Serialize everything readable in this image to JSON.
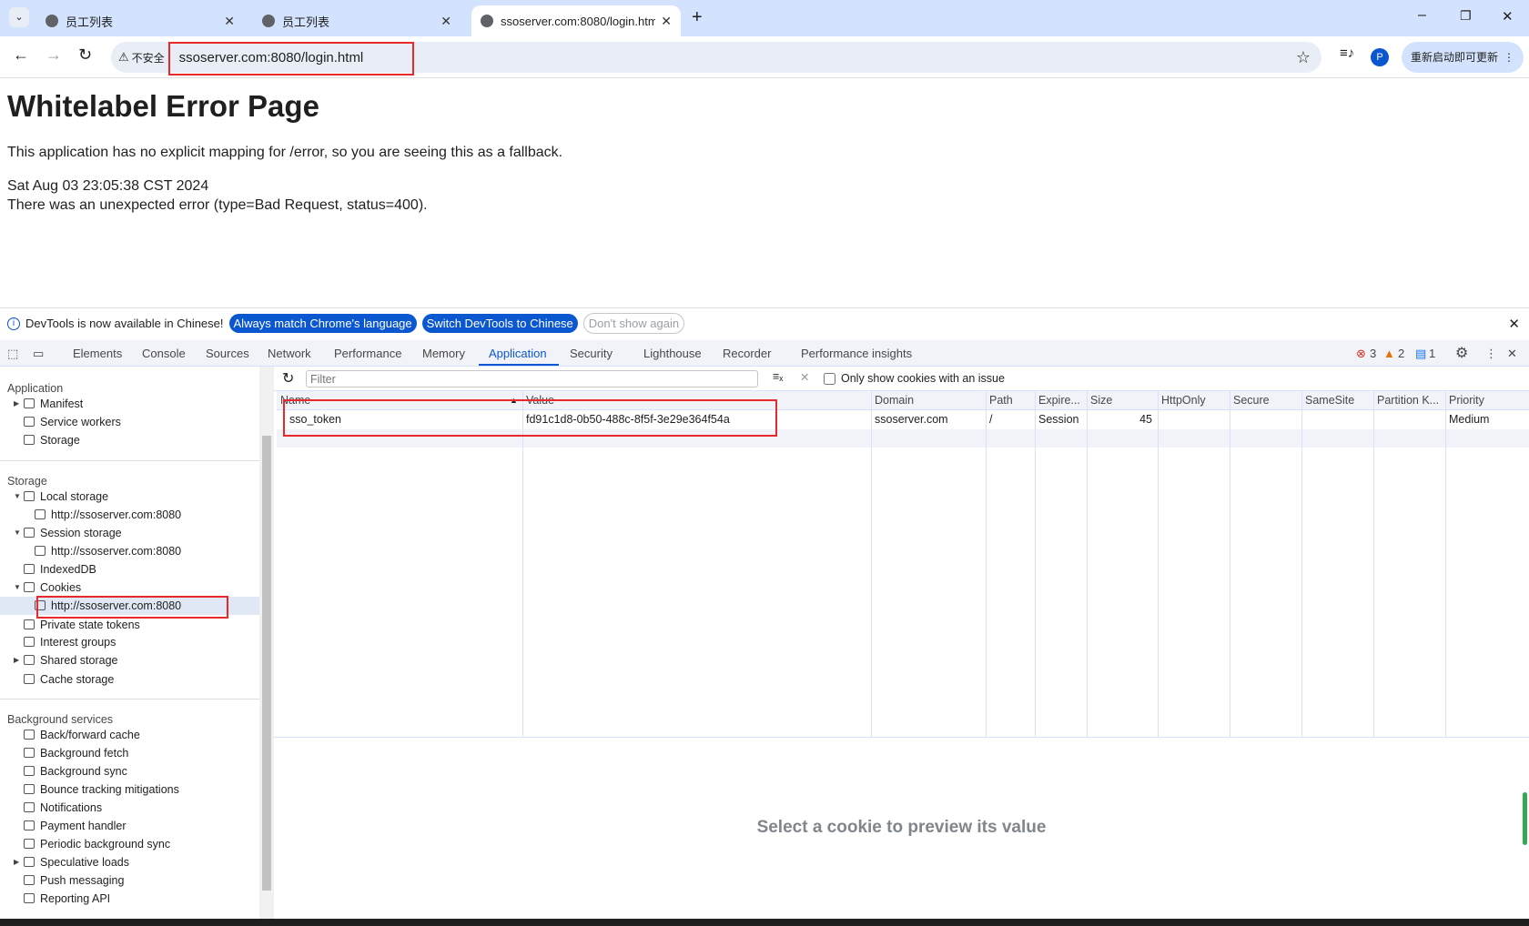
{
  "browser": {
    "tabs": [
      {
        "title": "员工列表"
      },
      {
        "title": "员工列表"
      },
      {
        "title": "ssoserver.com:8080/login.htm"
      }
    ],
    "security_label": "不安全",
    "url": "ssoserver.com:8080/login.html",
    "profile_initial": "P",
    "update_button": "重新启动即可更新"
  },
  "page": {
    "title": "Whitelabel Error Page",
    "message": "This application has no explicit mapping for /error, so you are seeing this as a fallback.",
    "timestamp": "Sat Aug 03 23:05:38 CST 2024",
    "error": "There was an unexpected error (type=Bad Request, status=400)."
  },
  "infobar": {
    "text": "DevTools is now available in Chinese!",
    "btn1": "Always match Chrome's language",
    "btn2": "Switch DevTools to Chinese",
    "btn3": "Don't show again"
  },
  "devtools": {
    "tabs": [
      "Elements",
      "Console",
      "Sources",
      "Network",
      "Performance",
      "Memory",
      "Application",
      "Security",
      "Lighthouse",
      "Recorder",
      "Performance insights"
    ],
    "active_tab": "Application",
    "errors": "3",
    "warnings": "2",
    "info": "1"
  },
  "sidebar": {
    "sections": [
      {
        "title": "Application",
        "items": [
          "Manifest",
          "Service workers",
          "Storage"
        ]
      },
      {
        "title": "Storage",
        "items": [
          "Local storage",
          "http://ssoserver.com:8080",
          "Session storage",
          "http://ssoserver.com:8080",
          "IndexedDB",
          "Cookies",
          "http://ssoserver.com:8080",
          "Private state tokens",
          "Interest groups",
          "Shared storage",
          "Cache storage"
        ]
      },
      {
        "title": "Background services",
        "items": [
          "Back/forward cache",
          "Background fetch",
          "Background sync",
          "Bounce tracking mitigations",
          "Notifications",
          "Payment handler",
          "Periodic background sync",
          "Speculative loads",
          "Push messaging",
          "Reporting API"
        ]
      }
    ]
  },
  "cookies": {
    "filter_placeholder": "Filter",
    "only_issues_label": "Only show cookies with an issue",
    "columns": [
      "Name",
      "Value",
      "Domain",
      "Path",
      "Expire...",
      "Size",
      "HttpOnly",
      "Secure",
      "SameSite",
      "Partition K...",
      "Priority"
    ],
    "rows": [
      [
        "sso_token",
        "fd91c1d8-0b50-488c-8f5f-3e29e364f54a",
        "ssoserver.com",
        "/",
        "Session",
        "45",
        "",
        "",
        "",
        "",
        "Medium"
      ]
    ],
    "preview_placeholder": "Select a cookie to preview its value"
  }
}
